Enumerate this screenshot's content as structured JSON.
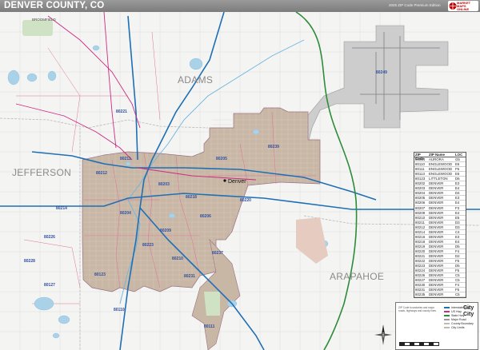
{
  "title": "DENVER COUNTY, CO",
  "edition_note": "2025 ZIP Code Premium Edition",
  "logo": {
    "lines": [
      "MARKET",
      "MAPS",
      "ONLINE"
    ]
  },
  "counties": [
    {
      "name": "ADAMS"
    },
    {
      "name": "JEFFERSON"
    },
    {
      "name": "ARAPAHOE"
    },
    {
      "name": "BROOMFIELD"
    }
  ],
  "city": "Denver",
  "zip_labels": [
    "80221",
    "80212",
    "80204",
    "80203",
    "80239",
    "80214",
    "80226",
    "80223",
    "80237",
    "80231",
    "80110",
    "80111",
    "80249",
    "80123",
    "80127",
    "80228",
    "80218",
    "80206",
    "80209",
    "80210",
    "80220",
    "80205",
    "80211"
  ],
  "zip_index": {
    "headers": [
      "ZIP Code",
      "ZIP Name",
      "LOC"
    ],
    "rows": [
      [
        "80014",
        "AURORA",
        "G5"
      ],
      [
        "80110",
        "ENGLEWOOD",
        "E6"
      ],
      [
        "80111",
        "ENGLEWOOD",
        "F6"
      ],
      [
        "80113",
        "ENGLEWOOD",
        "E6"
      ],
      [
        "80123",
        "LITTLETON",
        "D6"
      ],
      [
        "80202",
        "DENVER",
        "E3"
      ],
      [
        "80203",
        "DENVER",
        "E4"
      ],
      [
        "80204",
        "DENVER",
        "D4"
      ],
      [
        "80205",
        "DENVER",
        "E3"
      ],
      [
        "80206",
        "DENVER",
        "E4"
      ],
      [
        "80207",
        "DENVER",
        "F3"
      ],
      [
        "80209",
        "DENVER",
        "E4"
      ],
      [
        "80210",
        "DENVER",
        "E5"
      ],
      [
        "80211",
        "DENVER",
        "D3"
      ],
      [
        "80212",
        "DENVER",
        "D3"
      ],
      [
        "80214",
        "DENVER",
        "C4"
      ],
      [
        "80216",
        "DENVER",
        "E3"
      ],
      [
        "80218",
        "DENVER",
        "E4"
      ],
      [
        "80219",
        "DENVER",
        "D5"
      ],
      [
        "80220",
        "DENVER",
        "F4"
      ],
      [
        "80221",
        "DENVER",
        "D2"
      ],
      [
        "80222",
        "DENVER",
        "F5"
      ],
      [
        "80223",
        "DENVER",
        "D5"
      ],
      [
        "80224",
        "DENVER",
        "F5"
      ],
      [
        "80226",
        "DENVER",
        "C5"
      ],
      [
        "80227",
        "DENVER",
        "C5"
      ],
      [
        "80230",
        "DENVER",
        "F4"
      ],
      [
        "80231",
        "DENVER",
        "F5"
      ],
      [
        "80235",
        "DENVER",
        "C5"
      ],
      [
        "80236",
        "DENVER",
        "D5"
      ],
      [
        "80237",
        "DENVER",
        "F5"
      ],
      [
        "80238",
        "DENVER",
        "F3"
      ],
      [
        "80239",
        "DENVER",
        "G3"
      ],
      [
        "80246",
        "DENVER",
        "F4"
      ],
      [
        "80247",
        "DENVER",
        "F5"
      ],
      [
        "80249",
        "DENVER",
        "H2"
      ]
    ]
  },
  "legend": {
    "rows": [
      "Interstate Hwy",
      "US Hwy",
      "State Hwy",
      "Major Road",
      "County Boundary",
      "City Limits"
    ],
    "big": [
      "City",
      "City"
    ],
    "note": "ZIP Code boundaries and major roads, highways and county lines"
  },
  "colors": {
    "background": "#f4f5f3",
    "city_fill": "#c6b6a4",
    "airport": "#c9c9c9",
    "water": "#a9d1e8",
    "interstate": "#1f6fb4",
    "us_hwy": "#cc2a84",
    "state_hwy": "#2e8b3a",
    "zip_line": "#e35a8a"
  }
}
